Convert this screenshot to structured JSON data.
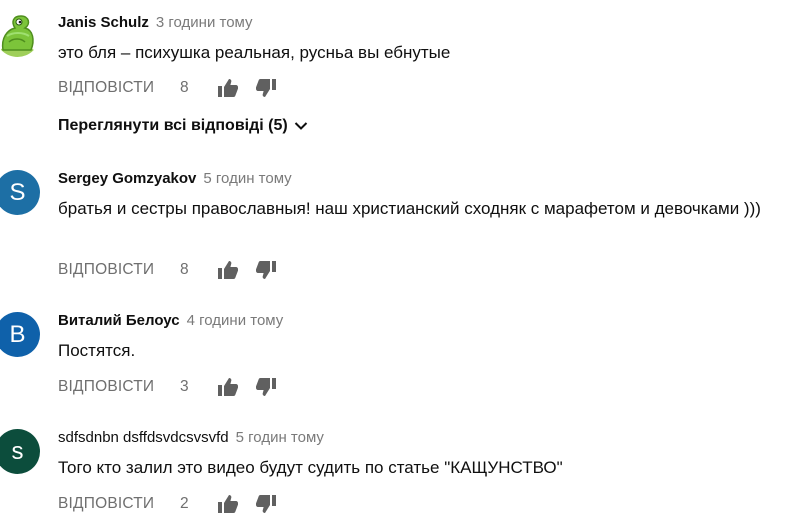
{
  "comments": [
    {
      "author": "Janis Schulz",
      "time": "3 години тому",
      "text": "это бля – психушка реальная, русньа вы ебнутые",
      "reply_label": "ВІДПОВІСТИ",
      "likes": "8",
      "avatar_letter": "",
      "avatar_kind": "image",
      "view_replies_label": "Переглянути всі відповіді (5)"
    },
    {
      "author": "Sergey Gomzyakov",
      "time": "5 годин тому",
      "text": "братья и сестры православныя!  наш христианский сходняк с марафетом и девочками )))",
      "reply_label": "ВІДПОВІСТИ",
      "likes": "8",
      "avatar_letter": "S",
      "avatar_color": "#1d6fa5"
    },
    {
      "author": "Виталий Белоус",
      "time": "4 години тому",
      "text": "Постятся.",
      "reply_label": "ВІДПОВІСТИ",
      "likes": "3",
      "avatar_letter": "B",
      "avatar_color": "#0f61aa"
    },
    {
      "author": "sdfsdnbn dsffdsvdcsvsvfd",
      "time": "5 годин тому",
      "text": "Того кто залил это видео будут судить по статье \"КАЩУНСТВО\"",
      "reply_label": "ВІДПОВІСТИ",
      "likes": "2",
      "avatar_letter": "s",
      "avatar_color": "#0c4d3c"
    }
  ],
  "icons": {
    "like": "thumb-up-icon",
    "dislike": "thumb-down-icon",
    "expand": "chevron-down-icon"
  },
  "colors": {
    "text": "#0f0f0f",
    "muted": "#6f6f6f",
    "time": "#7a7a7a",
    "icon": "#606060"
  }
}
